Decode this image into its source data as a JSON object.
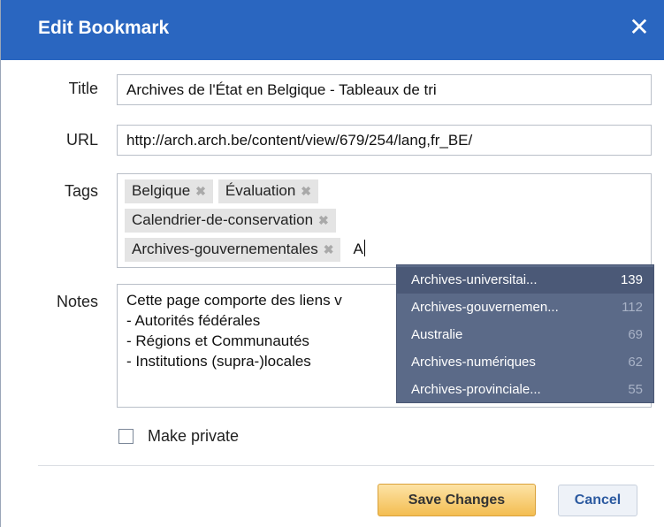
{
  "dialog": {
    "title": "Edit Bookmark",
    "close_glyph": "✕",
    "title_bar_color": "#2a66c0"
  },
  "form": {
    "title_label": "Title",
    "title_value": "Archives de l'État en Belgique - Tableaux de tri",
    "url_label": "URL",
    "url_value": "http://arch.arch.be/content/view/679/254/lang,fr_BE/",
    "tags_label": "Tags",
    "tags": [
      {
        "label": "Belgique"
      },
      {
        "label": "Évaluation"
      },
      {
        "label": "Calendrier-de-conservation"
      },
      {
        "label": "Archives-gouvernementales"
      }
    ],
    "tag_remove_glyph": "✖",
    "tag_input_value": "A",
    "notes_label": "Notes",
    "notes_lines": [
      "Cette page comporte des liens v",
      "- Autorités fédérales",
      "- Régions et Communautés",
      "- Institutions (supra-)locales"
    ],
    "private_label": "Make private",
    "private_checked": false
  },
  "suggestions": [
    {
      "name": "Archives-universitai...",
      "count": "139",
      "active": true
    },
    {
      "name": "Archives-gouvernemen...",
      "count": "112",
      "active": false
    },
    {
      "name": "Australie",
      "count": "69",
      "active": false
    },
    {
      "name": "Archives-numériques",
      "count": "62",
      "active": false
    },
    {
      "name": "Archives-provinciale...",
      "count": "55",
      "active": false
    }
  ],
  "buttons": {
    "save_label": "Save Changes",
    "cancel_label": "Cancel"
  },
  "icons": {
    "close": "close-icon",
    "tag_remove": "remove-tag-icon",
    "checkbox": "checkbox-icon"
  },
  "colors": {
    "accent": "#2a66c0",
    "save_button": "#f3bd51",
    "suggestion_bg": "#5b6a88",
    "tag_bg": "#e4e4e4"
  }
}
